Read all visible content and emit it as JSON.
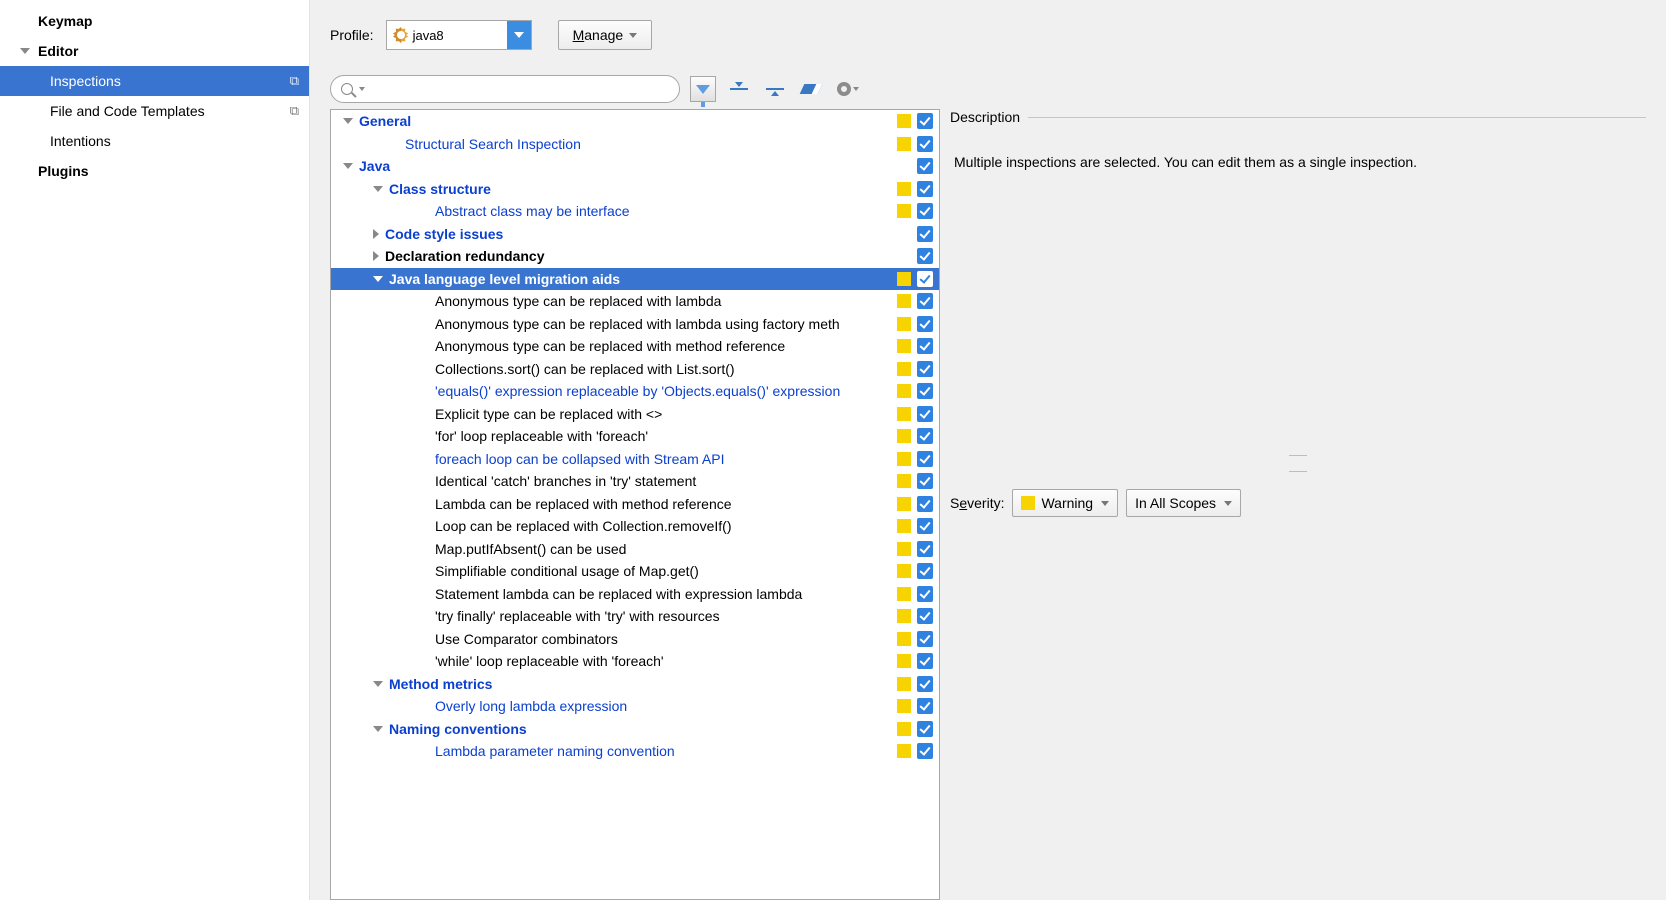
{
  "sidebar": {
    "keymap": "Keymap",
    "editor": "Editor",
    "inspections": "Inspections",
    "fileTemplates": "File and Code Templates",
    "intentions": "Intentions",
    "plugins": "Plugins"
  },
  "profile": {
    "label": "Profile:",
    "value": "java8",
    "manage": "Manage"
  },
  "severity": {
    "label": "Severity:",
    "value": "Warning",
    "scope": "In All Scopes"
  },
  "description": {
    "title": "Description",
    "body": "Multiple inspections are selected. You can edit them as a single inspection."
  },
  "tree": [
    {
      "depth": 0,
      "label": "General",
      "style": "cat-blue",
      "expand": "down",
      "yellow": true,
      "check": true
    },
    {
      "depth": 1,
      "label": "Structural Search Inspection",
      "style": "link-blue",
      "yellow": true,
      "check": true
    },
    {
      "depth": 0,
      "label": "Java",
      "style": "cat-blue",
      "expand": "down",
      "check": true
    },
    {
      "depth": 1,
      "label": "Class structure",
      "style": "cat-blue",
      "expand": "down",
      "yellow": true,
      "check": true
    },
    {
      "depth": 2,
      "label": "Abstract class may be interface",
      "style": "link-blue",
      "yellow": true,
      "check": true
    },
    {
      "depth": 1,
      "label": "Code style issues",
      "style": "cat-blue",
      "expand": "right",
      "check": true
    },
    {
      "depth": 1,
      "label": "Declaration redundancy",
      "style": "cat-black",
      "expand": "right",
      "check": true
    },
    {
      "depth": 1,
      "label": "Java language level migration aids",
      "style": "cat-blue",
      "expand": "down",
      "yellow": true,
      "check": true,
      "selected": true
    },
    {
      "depth": 2,
      "label": "Anonymous type can be replaced with lambda",
      "yellow": true,
      "check": true
    },
    {
      "depth": 2,
      "label": "Anonymous type can be replaced with lambda using factory meth",
      "yellow": true,
      "check": true
    },
    {
      "depth": 2,
      "label": "Anonymous type can be replaced with method reference",
      "yellow": true,
      "check": true
    },
    {
      "depth": 2,
      "label": "Collections.sort() can be replaced with List.sort()",
      "yellow": true,
      "check": true
    },
    {
      "depth": 2,
      "label": "'equals()' expression replaceable by 'Objects.equals()' expression",
      "style": "link-blue",
      "yellow": true,
      "check": true
    },
    {
      "depth": 2,
      "label": "Explicit type can be replaced with <>",
      "yellow": true,
      "check": true
    },
    {
      "depth": 2,
      "label": "'for' loop replaceable with 'foreach'",
      "yellow": true,
      "check": true
    },
    {
      "depth": 2,
      "label": "foreach loop can be collapsed with Stream API",
      "style": "link-blue",
      "yellow": true,
      "check": true
    },
    {
      "depth": 2,
      "label": "Identical 'catch' branches in 'try' statement",
      "yellow": true,
      "check": true
    },
    {
      "depth": 2,
      "label": "Lambda can be replaced with method reference",
      "yellow": true,
      "check": true
    },
    {
      "depth": 2,
      "label": "Loop can be replaced with Collection.removeIf()",
      "yellow": true,
      "check": true
    },
    {
      "depth": 2,
      "label": "Map.putIfAbsent() can be used",
      "yellow": true,
      "check": true
    },
    {
      "depth": 2,
      "label": "Simplifiable conditional usage of Map.get()",
      "yellow": true,
      "check": true
    },
    {
      "depth": 2,
      "label": "Statement lambda can be replaced with expression lambda",
      "yellow": true,
      "check": true
    },
    {
      "depth": 2,
      "label": "'try finally' replaceable with 'try' with resources",
      "yellow": true,
      "check": true
    },
    {
      "depth": 2,
      "label": "Use Comparator combinators",
      "yellow": true,
      "check": true
    },
    {
      "depth": 2,
      "label": "'while' loop replaceable with 'foreach'",
      "yellow": true,
      "check": true
    },
    {
      "depth": 1,
      "label": "Method metrics",
      "style": "cat-blue",
      "expand": "down",
      "yellow": true,
      "check": true
    },
    {
      "depth": 2,
      "label": "Overly long lambda expression",
      "style": "link-blue",
      "yellow": true,
      "check": true
    },
    {
      "depth": 1,
      "label": "Naming conventions",
      "style": "cat-blue",
      "expand": "down",
      "yellow": true,
      "check": true
    },
    {
      "depth": 2,
      "label": "Lambda parameter naming convention",
      "style": "link-blue",
      "yellow": true,
      "check": true
    }
  ]
}
